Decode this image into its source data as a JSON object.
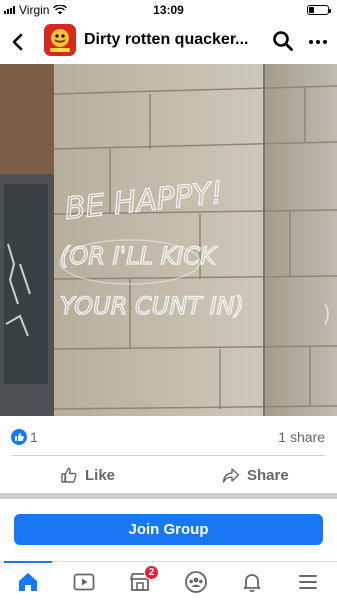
{
  "status_bar": {
    "carrier": "Virgin",
    "time": "13:09",
    "battery_level": 0.25
  },
  "header": {
    "group_name": "Dirty rotten quacker...",
    "back_icon": "chevron-left-icon",
    "search_icon": "search-icon",
    "more_icon": "more-dots-icon"
  },
  "post": {
    "photo_text_lines": [
      "BE HAPPY!",
      "(OR I'LL KICK",
      "YOUR CUNT IN)"
    ],
    "like_count": "1",
    "share_count": "1 share",
    "like_label": "Like",
    "share_label": "Share"
  },
  "join_button": {
    "label": "Join Group"
  },
  "bottom_nav": {
    "items": [
      {
        "icon": "home-icon",
        "active": true
      },
      {
        "icon": "video-icon"
      },
      {
        "icon": "marketplace-icon",
        "badge": "2"
      },
      {
        "icon": "groups-icon"
      },
      {
        "icon": "bell-icon"
      },
      {
        "icon": "menu-icon"
      }
    ]
  },
  "colors": {
    "accent": "#1877f2",
    "badge": "#e41e3f",
    "muted_text": "#65676b"
  }
}
